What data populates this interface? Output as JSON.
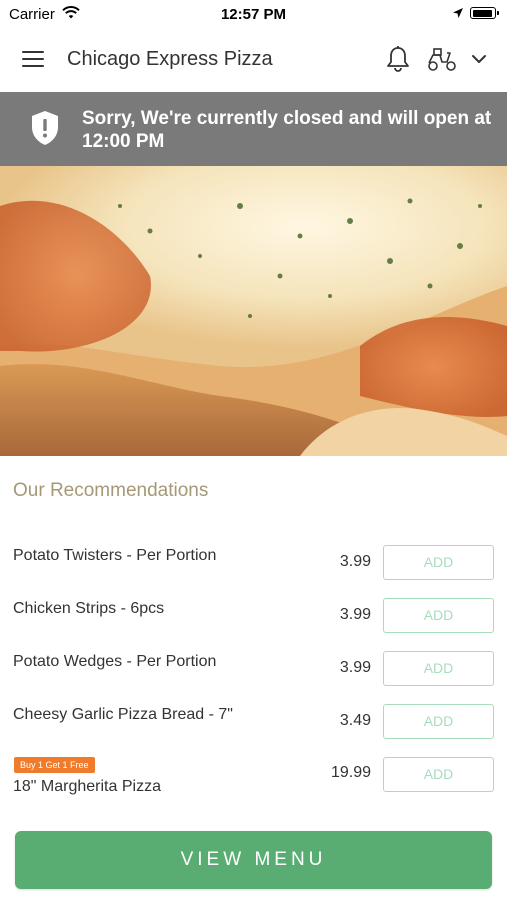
{
  "status_bar": {
    "carrier": "Carrier",
    "time": "12:57 PM"
  },
  "header": {
    "title": "Chicago Express Pizza"
  },
  "banner": {
    "message": "Sorry, We're currently closed and will open at 12:00 PM"
  },
  "recommendations": {
    "title": "Our Recommendations",
    "add_label": "ADD",
    "items": [
      {
        "name": "Potato Twisters - Per Portion",
        "price": "3.99"
      },
      {
        "name": "Chicken Strips - 6pcs",
        "price": "3.99"
      },
      {
        "name": "Potato Wedges - Per Portion",
        "price": "3.99"
      },
      {
        "name": "Cheesy Garlic Pizza Bread - 7\"",
        "price": "3.49"
      },
      {
        "name": "18\" Margherita Pizza",
        "price": "19.99",
        "badge": "Buy 1 Get 1 Free"
      }
    ]
  },
  "footer": {
    "view_menu_label": "VIEW MENU"
  },
  "colors": {
    "accent_green": "#5aad72",
    "banner_gray": "#7a7a7a",
    "badge_orange": "#f07b2a",
    "section_title": "#a69877"
  },
  "icons": [
    "menu-icon",
    "bell-icon",
    "scooter-icon",
    "chevron-down-icon",
    "shield-icon",
    "wifi-icon",
    "location-arrow-icon",
    "battery-icon"
  ]
}
